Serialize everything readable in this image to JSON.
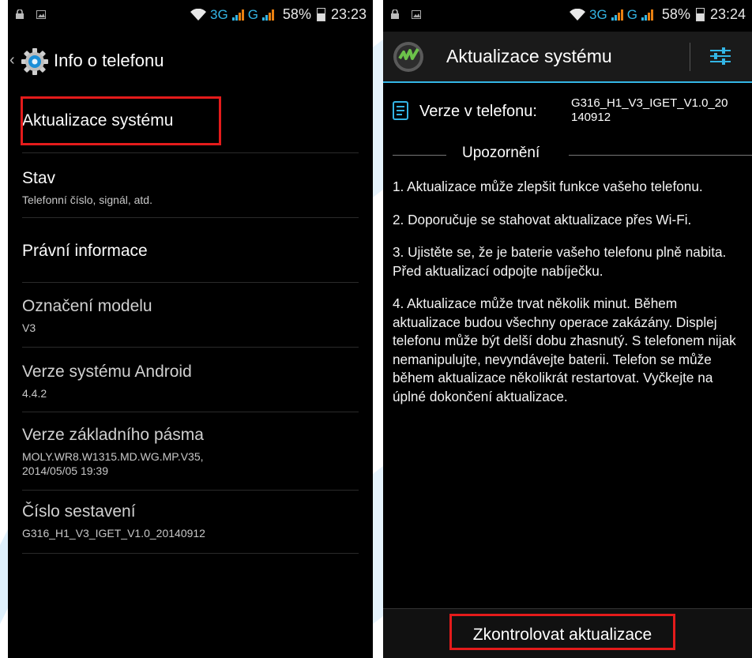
{
  "left": {
    "status_bar": {
      "network": "3G",
      "battery": "58%",
      "time": "23:23"
    },
    "action_bar": {
      "title": "Info o telefonu"
    },
    "items": [
      {
        "title": "Aktualizace systému",
        "subtitle": ""
      },
      {
        "title": "Stav",
        "subtitle": "Telefonní číslo, signál, atd."
      },
      {
        "title": "Právní informace",
        "subtitle": ""
      },
      {
        "title": "Označení modelu",
        "subtitle": "V3"
      },
      {
        "title": "Verze systému Android",
        "subtitle": "4.4.2"
      },
      {
        "title": "Verze základního pásma",
        "subtitle": "MOLY.WR8.W1315.MD.WG.MP.V35,",
        "subtitle2": "2014/05/05 19:39"
      },
      {
        "title": "Číslo sestavení",
        "subtitle": "G316_H1_V3_IGET_V1.0_20140912"
      }
    ]
  },
  "right": {
    "status_bar": {
      "network": "3G",
      "battery": "58%",
      "time": "23:24"
    },
    "action_bar": {
      "title": "Aktualizace systému"
    },
    "version_label": "Verze v telefonu:",
    "version_value_1": "G316_H1_V3_IGET_V1.0_20",
    "version_value_2": "140912",
    "warning_title": "Upozornění",
    "notices": [
      "1. Aktualizace může zlepšit funkce vašeho telefonu.",
      "2. Doporučuje se stahovat aktualizace přes Wi-Fi.",
      "3. Ujistěte se, že je baterie vašeho telefonu plně nabita. Před aktualizací odpojte nabíječku.",
      "4. Aktualizace může trvat několik minut. Během aktualizace budou všechny operace zakázány. Displej telefonu může být delší dobu zhasnutý. S telefonem nijak nemanipulujte, nevyndávejte baterii. Telefon se může během aktualizace několikrát restartovat. Vyčkejte na úplné dokončení aktualizace."
    ],
    "button_label": "Zkontrolovat aktualizace"
  },
  "colors": {
    "accent": "#33b5e5",
    "highlight": "#e41b1b",
    "signal_orange": "#e87f10"
  },
  "icons": [
    "lock-icon",
    "image-icon",
    "wifi-icon",
    "signal-icon",
    "battery-icon",
    "settings-gear-icon",
    "app-logo-icon",
    "document-icon",
    "sliders-icon"
  ]
}
